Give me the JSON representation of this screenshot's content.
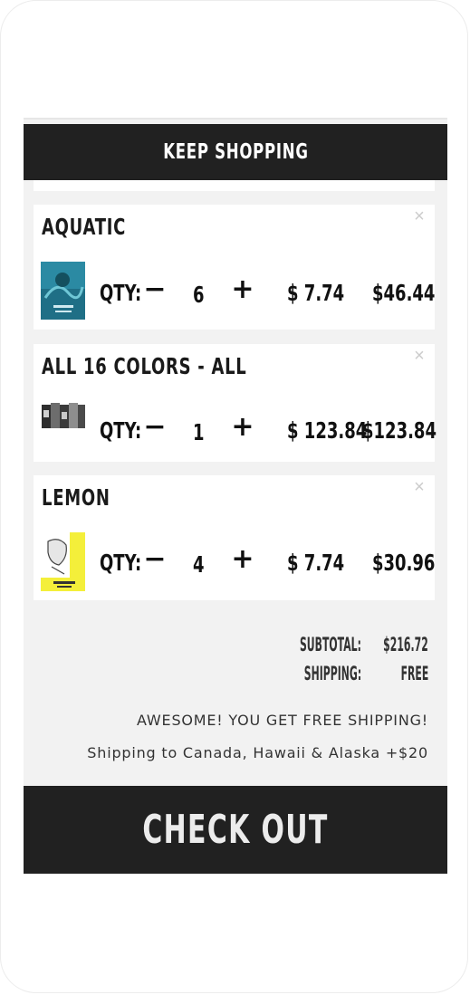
{
  "header": {
    "keep_shopping_label": "KEEP SHOPPING"
  },
  "items": [
    {
      "name": "AQUATIC",
      "qty_label": "QTY:",
      "qty": "6",
      "unit_price": "$ 7.74",
      "total": "$46.44",
      "minus": "−",
      "plus": "+",
      "remove": "×"
    },
    {
      "name": "ALL 16 COLORS - ALL",
      "qty_label": "QTY:",
      "qty": "1",
      "unit_price": "$ 123.84",
      "total": "$123.84",
      "minus": "−",
      "plus": "+",
      "remove": "×"
    },
    {
      "name": "LEMON",
      "qty_label": "QTY:",
      "qty": "4",
      "unit_price": "$ 7.74",
      "total": "$30.96",
      "minus": "−",
      "plus": "+",
      "remove": "×"
    }
  ],
  "summary": {
    "subtotal_label": "SUBTOTAL:",
    "subtotal_value": "$216.72",
    "shipping_label": "SHIPPING:",
    "shipping_value": "FREE",
    "free_shipping_message": "AWESOME! YOU GET FREE SHIPPING!",
    "extra_shipping_note": "Shipping to Canada, Hawaii & Alaska +$20"
  },
  "checkout": {
    "label": "CHECK OUT"
  },
  "colors": {
    "dark": "#212121",
    "panel": "#f2f2f2",
    "card": "#ffffff",
    "remove": "#cccccc"
  }
}
